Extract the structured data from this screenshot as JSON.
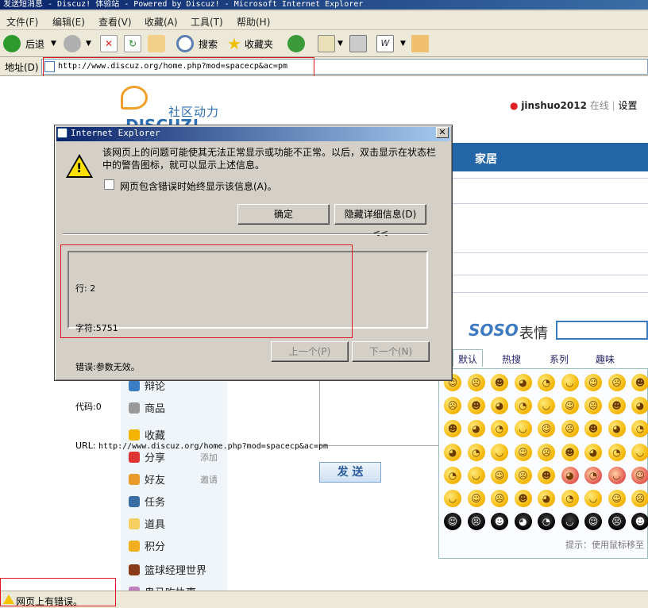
{
  "window": {
    "title": "发送短消息 - Discuz! 体验站 - Powered by Discuz! - Microsoft Internet Explorer"
  },
  "menu": [
    "文件(F)",
    "编辑(E)",
    "查看(V)",
    "收藏(A)",
    "工具(T)",
    "帮助(H)"
  ],
  "toolbar": {
    "back": "后退",
    "search": "搜索",
    "favorites": "收藏夹"
  },
  "address": {
    "label": "地址(D)",
    "url": "http://www.discuz.org/home.php?mod=spacecp&ac=pm"
  },
  "site": {
    "logo_tagline": "社区动力",
    "logo_word": "DISCUZ!",
    "username": "jinshuo2012",
    "online": "在线",
    "settings": "设置",
    "nav_home": "家居"
  },
  "sidebar": [
    {
      "label": "辩论",
      "extra": ""
    },
    {
      "label": "商品",
      "extra": ""
    },
    {
      "label": "收藏",
      "extra": ""
    },
    {
      "label": "分享",
      "extra": "添加"
    },
    {
      "label": "好友",
      "extra": "邀请"
    },
    {
      "label": "任务",
      "extra": ""
    },
    {
      "label": "道具",
      "extra": ""
    },
    {
      "label": "积分",
      "extra": ""
    },
    {
      "label": "篮球经理世界",
      "extra": ""
    },
    {
      "label": "鬼马吃执事",
      "extra": ""
    }
  ],
  "compose": {
    "send_label": "发 送"
  },
  "soso": {
    "brand": "SOSO",
    "label": "表情"
  },
  "emoji": {
    "tabs": [
      "默认",
      "热搜",
      "系列",
      "趣味"
    ],
    "hint": "提示：使用鼠标移至"
  },
  "dialog": {
    "title": "Internet Explorer",
    "message": "该网页上的问题可能使其无法正常显示或功能不正常。以后，双击显示在状态栏中的警告图标，就可以显示上述信息。",
    "checkbox": "网页包含错误时始终显示该信息(A)。",
    "ok": "确定",
    "details": "隐藏详细信息(D) <<",
    "prev": "上一个(P)",
    "next": "下一个(N)",
    "error": {
      "line_label": "行:",
      "line": "2",
      "char_label": "字符:",
      "char": "5751",
      "error_label": "错误:",
      "error": "参数无效。",
      "code_label": "代码:",
      "code": "0",
      "url_label": "URL:",
      "url": "http://www.discuz.org/home.php?mod=spacecp&ac=pm"
    }
  },
  "status": {
    "text": "网页上有错误。"
  }
}
